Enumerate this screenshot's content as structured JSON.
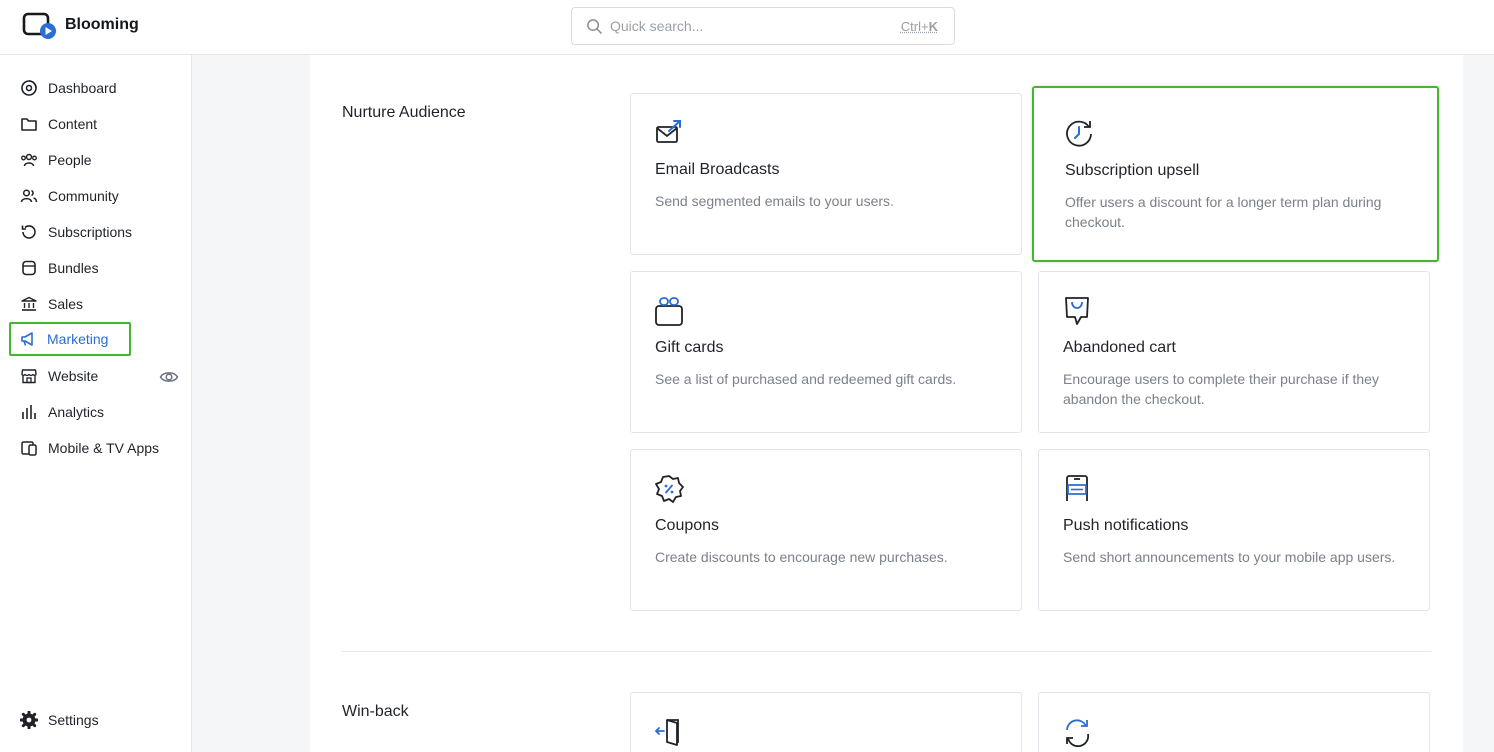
{
  "app": {
    "name": "Blooming",
    "search_placeholder": "Quick search...",
    "search_shortcut_prefix": "Ctrl+",
    "search_shortcut_key": "K"
  },
  "sidebar": {
    "items": [
      {
        "label": "Dashboard",
        "icon": "dashboard-icon"
      },
      {
        "label": "Content",
        "icon": "folder-icon"
      },
      {
        "label": "People",
        "icon": "people-icon"
      },
      {
        "label": "Community",
        "icon": "community-icon"
      },
      {
        "label": "Subscriptions",
        "icon": "subscriptions-icon"
      },
      {
        "label": "Bundles",
        "icon": "bundles-icon"
      },
      {
        "label": "Sales",
        "icon": "bank-icon"
      },
      {
        "label": "Marketing",
        "icon": "megaphone-icon",
        "active": true
      },
      {
        "label": "Website",
        "icon": "storefront-icon"
      },
      {
        "label": "Analytics",
        "icon": "bar-chart-icon"
      },
      {
        "label": "Mobile & TV Apps",
        "icon": "devices-icon"
      }
    ],
    "settings_label": "Settings"
  },
  "sections": [
    {
      "title": "Nurture Audience",
      "cards": [
        {
          "title": "Email Broadcasts",
          "description": "Send segmented emails to your users.",
          "icon": "email-send-icon"
        },
        {
          "title": "Subscription upsell",
          "description": "Offer users a discount for a longer term plan during checkout.",
          "icon": "clock-refresh-icon",
          "highlighted": true
        },
        {
          "title": "Gift cards",
          "description": "See a list of purchased and redeemed gift cards.",
          "icon": "gift-icon"
        },
        {
          "title": "Abandoned cart",
          "description": "Encourage users to complete their purchase if they abandon the checkout.",
          "icon": "shopping-bag-icon"
        },
        {
          "title": "Coupons",
          "description": "Create discounts to encourage new purchases.",
          "icon": "coupon-icon"
        },
        {
          "title": "Push notifications",
          "description": "Send short announcements to your mobile app users.",
          "icon": "phone-notification-icon"
        }
      ]
    },
    {
      "title": "Win-back",
      "cards": [
        {
          "icon": "exit-door-icon"
        },
        {
          "icon": "refresh-icon"
        }
      ]
    }
  ],
  "colors": {
    "accent_blue": "#2a6dd3",
    "highlight_green": "#45b630",
    "page_bg": "#f4f6f8"
  }
}
